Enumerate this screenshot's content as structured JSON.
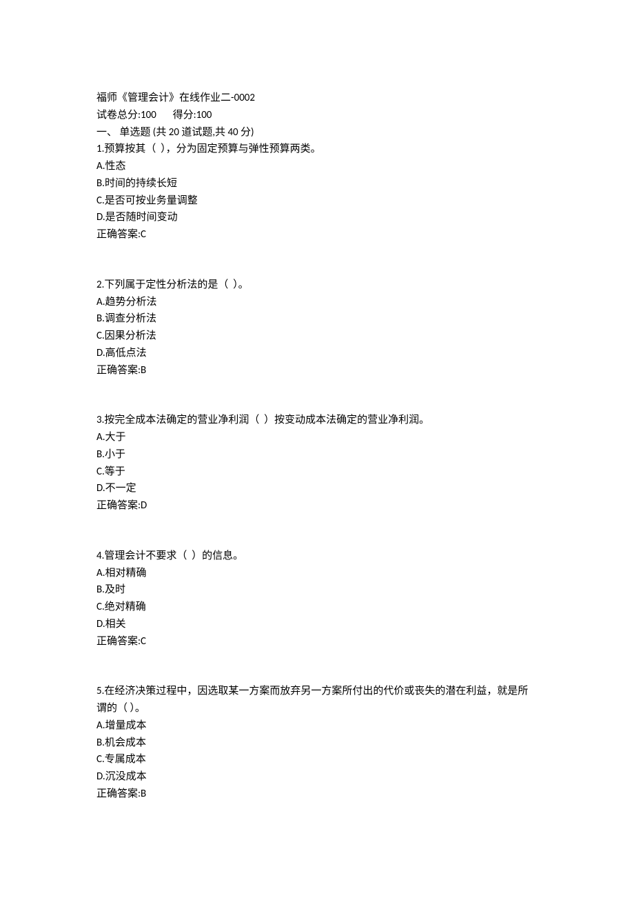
{
  "header": {
    "title": "福师《管理会计》在线作业二-0002",
    "totalScoreLabel": "试卷总分:",
    "totalScoreValue": "100",
    "gotScoreLabel": "得分:",
    "gotScoreValue": "100",
    "sectionLine": "一、 单选题 (共 20 道试题,共 40 分)"
  },
  "questions": [
    {
      "num": "1.",
      "stem": "预算按其（  ），分为固定预算与弹性预算两类。",
      "options": [
        "A.性态",
        "B.时间的持续长短",
        "C.是否可按业务量调整",
        "D.是否随时间变动"
      ],
      "answerLabel": "正确答案:",
      "answer": "C"
    },
    {
      "num": "2.",
      "stem": "下列属于定性分析法的是（  ）。",
      "options": [
        "A.趋势分析法",
        "B.调查分析法",
        "C.因果分析法",
        "D.高低点法"
      ],
      "answerLabel": "正确答案:",
      "answer": "B"
    },
    {
      "num": "3.",
      "stem": "按完全成本法确定的营业净利润（  ）按变动成本法确定的营业净利润。",
      "options": [
        "A.大于",
        "B.小于",
        "C.等于",
        "D.不一定"
      ],
      "answerLabel": "正确答案:",
      "answer": "D"
    },
    {
      "num": "4.",
      "stem": "管理会计不要求（  ）的信息。",
      "options": [
        "A.相对精确",
        "B.及时",
        "C.绝对精确",
        "D.相关"
      ],
      "answerLabel": "正确答案:",
      "answer": "C"
    },
    {
      "num": "5.",
      "stem": "在经济决策过程中，因选取某一方案而放弃另一方案所付出的代价或丧失的潜在利益，就是所谓的（ ）。",
      "options": [
        "A.增量成本",
        "B.机会成本",
        "C.专属成本",
        "D.沉没成本"
      ],
      "answerLabel": "正确答案:",
      "answer": "B"
    }
  ]
}
